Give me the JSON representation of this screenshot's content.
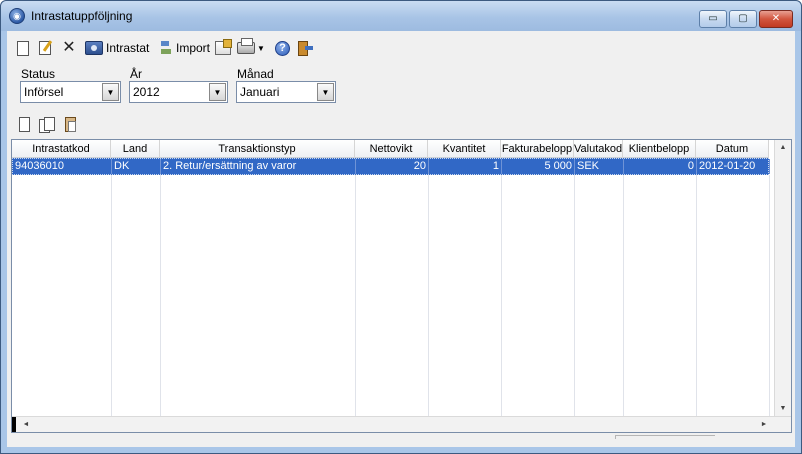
{
  "window": {
    "title": "Intrastatuppföljning",
    "app_icon_glyph": "◉"
  },
  "titlebar_buttons": {
    "minimize": "▭",
    "maximize": "▢",
    "close": "✕"
  },
  "toolbar": {
    "intrastat_label": "Intrastat",
    "import_label": "Import",
    "help_glyph": "?",
    "x_glyph": "✕",
    "caret_glyph": "▼"
  },
  "filters": {
    "status": {
      "label": "Status",
      "value": "Införsel"
    },
    "year": {
      "label": "År",
      "value": "2012"
    },
    "month": {
      "label": "Månad",
      "value": "Januari"
    },
    "dropdown_glyph": "▼"
  },
  "grid": {
    "columns": [
      "Intrastatkod",
      "Land",
      "Transaktionstyp",
      "Nettovikt",
      "Kvantitet",
      "Fakturabelopp",
      "Valutakod",
      "Klientbelopp",
      "Datum"
    ],
    "rows": [
      {
        "intrastatkod": "94036010",
        "land": "DK",
        "transaktionstyp": "2. Retur/ersättning av varor",
        "nettovikt": "20",
        "kvantitet": "1",
        "fakturabelopp": "5 000",
        "valutakod": "SEK",
        "klientbelopp": "0",
        "datum": "2012-01-20"
      }
    ]
  },
  "scroll": {
    "up": "▲",
    "down": "▼",
    "left": "◄",
    "right": "►"
  },
  "colors": {
    "selection": "#3168c6",
    "titlebar": "#a8c4e6",
    "close_button": "#d2553e"
  }
}
